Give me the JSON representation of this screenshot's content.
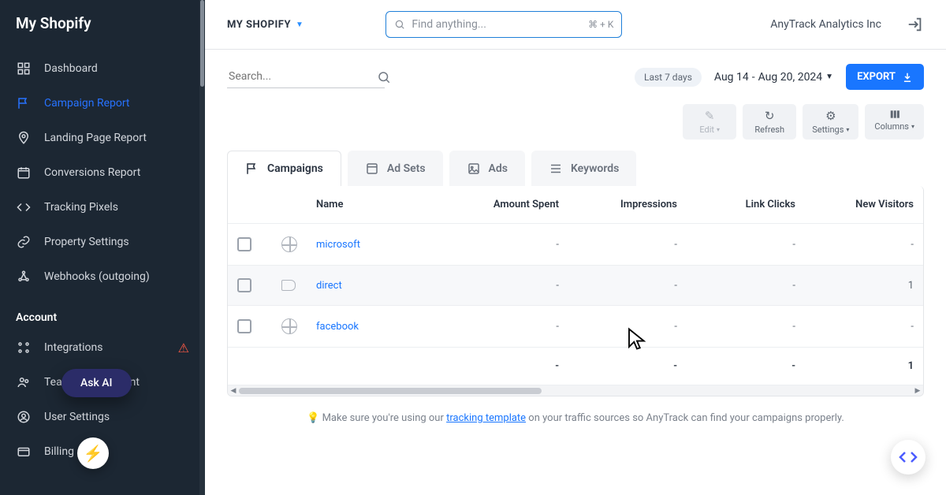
{
  "brand": "My Shopify",
  "sidebar": {
    "items": [
      {
        "label": "Dashboard",
        "icon": "dashboard-icon"
      },
      {
        "label": "Campaign Report",
        "icon": "flag-icon",
        "active": true
      },
      {
        "label": "Landing Page Report",
        "icon": "pin-icon"
      },
      {
        "label": "Conversions Report",
        "icon": "calendar-icon"
      },
      {
        "label": "Tracking Pixels",
        "icon": "code-icon"
      },
      {
        "label": "Property Settings",
        "icon": "link-icon"
      },
      {
        "label": "Webhooks (outgoing)",
        "icon": "webhook-icon"
      }
    ],
    "account_header": "Account",
    "account_items": [
      {
        "label": "Integrations",
        "icon": "integrations-icon",
        "warn": true
      },
      {
        "label": "Team Management",
        "icon": "team-icon"
      },
      {
        "label": "User Settings",
        "icon": "user-icon"
      },
      {
        "label": "Billing",
        "icon": "card-icon"
      }
    ],
    "ask_ai": "Ask AI"
  },
  "topbar": {
    "breadcrumb": "MY SHOPIFY",
    "search_placeholder": "Find anything...",
    "search_shortcut": "⌘ + K",
    "org": "AnyTrack Analytics Inc"
  },
  "filters": {
    "search_placeholder": "Search...",
    "range_label": "Last 7 days",
    "range_start": "Aug 14",
    "range_sep": "-",
    "range_end": "Aug 20, 2024",
    "export": "EXPORT"
  },
  "toolbar": {
    "edit": "Edit",
    "refresh": "Refresh",
    "settings": "Settings",
    "columns": "Columns"
  },
  "tabs": [
    "Campaigns",
    "Ad Sets",
    "Ads",
    "Keywords"
  ],
  "table": {
    "headers": [
      "Name",
      "Amount Spent",
      "Impressions",
      "Link Clicks",
      "New Visitors"
    ],
    "rows": [
      {
        "icon": "globe",
        "name": "microsoft",
        "spent": "-",
        "impr": "-",
        "clicks": "-",
        "nv": "-"
      },
      {
        "icon": "tag",
        "name": "direct",
        "spent": "-",
        "impr": "-",
        "clicks": "-",
        "nv": "1"
      },
      {
        "icon": "globe",
        "name": "facebook",
        "spent": "-",
        "impr": "-",
        "clicks": "-",
        "nv": "-"
      }
    ],
    "totals": {
      "spent": "-",
      "impr": "-",
      "clicks": "-",
      "nv": "1"
    }
  },
  "tip": {
    "pre": "Make sure you're using our ",
    "link": "tracking template",
    "post": " on your traffic sources so AnyTrack can find your campaigns properly."
  }
}
